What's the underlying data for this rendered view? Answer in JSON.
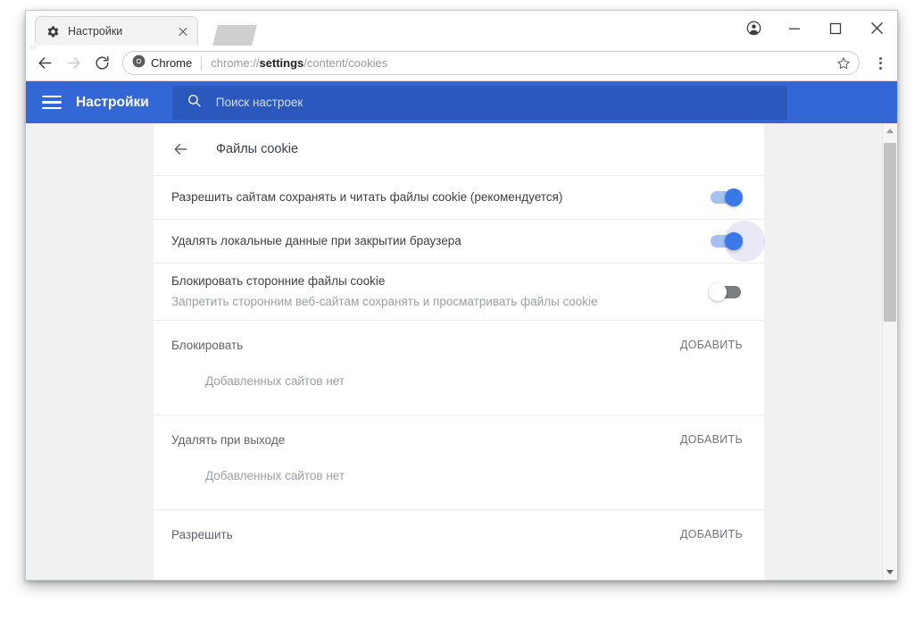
{
  "browser": {
    "tab": {
      "title": "Настройки",
      "favicon_icon": "gear-icon",
      "close_icon": "close-icon"
    },
    "new_tab_icon": "new-tab-ghost",
    "window_controls": {
      "profile_icon": "profile-avatar-icon",
      "minimize_icon": "minimize-icon",
      "maximize_icon": "maximize-icon",
      "close_icon": "window-close-icon"
    },
    "toolbar": {
      "back_icon": "back-arrow-icon",
      "forward_icon": "forward-arrow-icon",
      "reload_icon": "reload-icon",
      "chrome_chip_label": "Chrome",
      "chrome_chip_icon": "chrome-logo-icon",
      "url_prefix": "chrome://",
      "url_bold": "settings",
      "url_suffix": "/content/cookies",
      "star_icon": "bookmark-star-icon",
      "menu_icon": "three-dot-menu-icon"
    }
  },
  "settings_header": {
    "menu_icon": "hamburger-menu-icon",
    "title": "Настройки",
    "search_icon": "search-icon",
    "search_placeholder": "Поиск настроек",
    "bg_color": "#3367d6",
    "search_bg_color": "#2a58bd"
  },
  "page": {
    "back_icon": "back-arrow-icon",
    "title": "Файлы cookie",
    "toggles": [
      {
        "label": "Разрешить сайтам сохранять и читать файлы cookie (рекомендуется)",
        "state": "on"
      },
      {
        "label": "Удалять локальные данные при закрытии браузера",
        "state": "on",
        "focused": true
      },
      {
        "label": "Блокировать сторонние файлы cookie",
        "sublabel": "Запретить сторонним веб-сайтам сохранять и просматривать файлы cookie",
        "state": "off"
      }
    ],
    "sections": [
      {
        "title": "Блокировать",
        "add_label": "ДОБАВИТЬ",
        "empty_text": "Добавленных сайтов нет"
      },
      {
        "title": "Удалять при выходе",
        "add_label": "ДОБАВИТЬ",
        "empty_text": "Добавленных сайтов нет"
      },
      {
        "title": "Разрешить",
        "add_label": "ДОБАВИТЬ",
        "empty_text": ""
      }
    ],
    "toggle_on_color": "#3b78e7",
    "toggle_off_color": "#7b7f84"
  },
  "scrollbar": {
    "up_icon": "scroll-up-arrow-icon",
    "down_icon": "scroll-down-arrow-icon",
    "thumb_icon": "scrollbar-thumb"
  }
}
